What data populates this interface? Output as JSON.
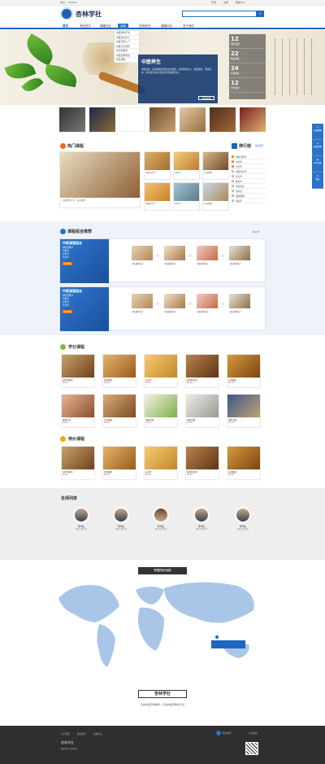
{
  "topbar": {
    "lang_cn": "中文",
    "lang_en": "English",
    "links": [
      "登录",
      "注册",
      "帮助中心"
    ]
  },
  "brand": {
    "name": "杏林学社",
    "accent": "#1e66c0"
  },
  "search": {
    "placeholder": "",
    "button_icon": "search-icon"
  },
  "nav": [
    "首页",
    "有效药方",
    "健康社区",
    "活动",
    "杏林资讯",
    "健康问诊",
    "关于我们"
  ],
  "dropdown": [
    "中医特色疗法",
    "中医养生学习",
    "中医诊断入门",
    "中医文化课堂",
    "中药药理学",
    "中医经典讲读",
    "更多课程"
  ],
  "hero": {
    "title": "中医养生",
    "desc": "中医养生，是指根据中医的生命规律，采用颐养身心、增强体质、预防疾病、延年益寿的方法所进行的保健活动。",
    "more": "查看详情",
    "stats": [
      {
        "num": "12",
        "label": "课程专题"
      },
      {
        "num": "22",
        "label": "精品课程"
      },
      {
        "num": "24",
        "label": "名师团队"
      },
      {
        "num": "12",
        "label": "合作院校"
      }
    ]
  },
  "hot": {
    "title": "热门课程",
    "rank_title": "排行榜",
    "rank_more": "更多排行",
    "feature_caption": "上海中医药大学 · 前青课程",
    "cards": [
      "中医养生学",
      "中药学",
      "针灸推拿",
      "中医养生学",
      "中药学",
      "针灸推拿"
    ],
    "rank": [
      "中医诊断学",
      "中药学",
      "方剂学",
      "中医内科学",
      "针灸学",
      "推拿学",
      "中医养生",
      "伤寒论",
      "金匮要略",
      "温病学"
    ]
  },
  "combo": {
    "title": "课程组合推荐",
    "more": "更多组合",
    "items": [
      {
        "name": "中医课程组合",
        "lines": [
          "中医诊断学",
          "中药学",
          "方剂学",
          "针灸学"
        ],
        "price": "¥299"
      },
      {
        "name": "中医课程组合",
        "lines": [
          "中医诊断学",
          "中药学",
          "方剂学",
          "针灸学"
        ],
        "price": "¥299"
      }
    ],
    "products": [
      "中医课程组合",
      "中医课程组合",
      "中医课程组合",
      "中医课程组合"
    ]
  },
  "credit": {
    "title": "学分课程",
    "cards": [
      "中药学概论",
      "本草纲目",
      "方剂学",
      "中药材识别",
      "方剂配伍",
      "推拿手法",
      "针灸基础",
      "中医药膳",
      "中医古籍",
      "中医书籍"
    ]
  },
  "special": {
    "title": "特价课程",
    "cards": [
      "中药学概论",
      "本草纲目",
      "方剂学",
      "中药材识别",
      "方剂配伍"
    ]
  },
  "teachers": {
    "title": "名师列表",
    "list": [
      {
        "name": "李华生",
        "desc": "著名中医学家"
      },
      {
        "name": "李华生",
        "desc": "著名中医学家"
      },
      {
        "name": "李华生",
        "desc": "著名中医学家"
      },
      {
        "name": "李华生",
        "desc": "著名中医学家"
      },
      {
        "name": "李华生",
        "desc": "著名中医学家"
      }
    ]
  },
  "map": {
    "title": "联盟院校地图",
    "brand": "杏林学社",
    "slogan": "弘扬中医药学精华，打造中医药教学平台"
  },
  "footer": {
    "brand": "杏林学社",
    "links": [
      "关于我们",
      "联系我们",
      "帮助中心"
    ],
    "copyright": "版权所有 杏林学社",
    "service": "联系我们",
    "qr_label": "关注我们"
  },
  "sidebar": [
    "在线客服",
    "电话咨询",
    "QQ咨询",
    "微信"
  ]
}
